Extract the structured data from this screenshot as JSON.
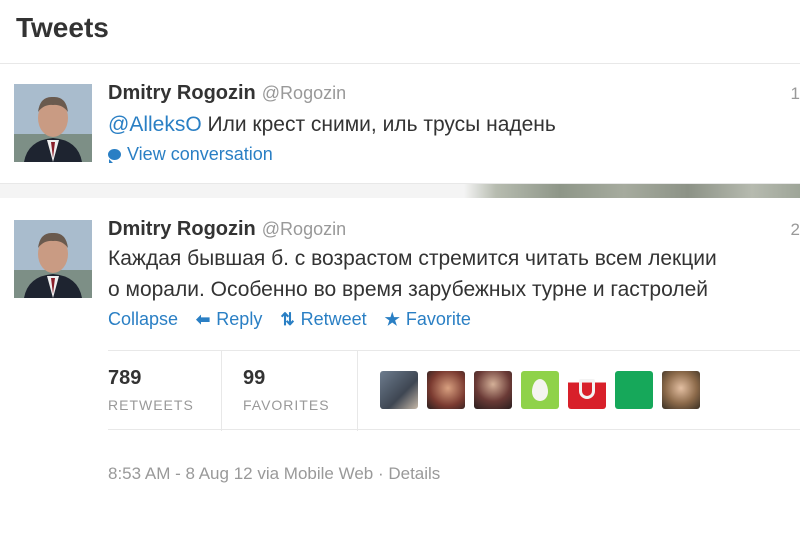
{
  "header": {
    "title": "Tweets"
  },
  "tweets": [
    {
      "name": "Dmitry Rogozin",
      "handle": "@Rogozin",
      "time": "1",
      "mention": "@AlleksO",
      "text": " Или крест сними, иль трусы надень",
      "view_conversation": "View conversation"
    },
    {
      "name": "Dmitry Rogozin",
      "handle": "@Rogozin",
      "time": "2",
      "text_line1": "Каждая бывшая б. с возрастом стремится читать всем лекции",
      "text_line2": "о морали. Особенно во время зарубежных турне и гастролей",
      "actions": {
        "collapse": "Collapse",
        "reply": "Reply",
        "retweet": "Retweet",
        "favorite": "Favorite"
      },
      "stats": {
        "retweets_count": "789",
        "retweets_label": "RETWEETS",
        "favorites_count": "99",
        "favorites_label": "FAVORITES"
      },
      "footer": "8:53 AM - 8 Aug 12 via Mobile Web · Details"
    }
  ],
  "colors": {
    "link": "#2a7fc4",
    "text": "#333333",
    "muted": "#999999",
    "border": "#e8e8e8"
  },
  "icons": [
    "speech-bubble-icon",
    "reply-arrow-icon",
    "retweet-icon",
    "star-icon"
  ]
}
